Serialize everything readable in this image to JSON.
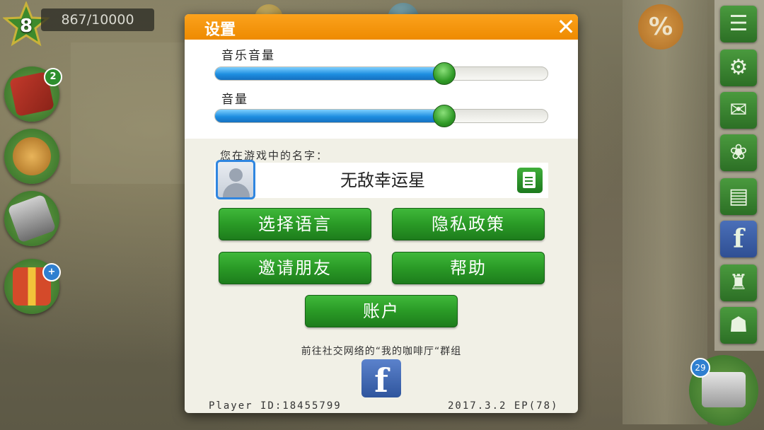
{
  "hud": {
    "level": "8",
    "xp": "867/10000",
    "discount_symbol": "%"
  },
  "left_buttons": [
    {
      "name": "recipe-book",
      "badge": "2"
    },
    {
      "name": "cooking-pot",
      "badge": ""
    },
    {
      "name": "telephone",
      "badge": ""
    },
    {
      "name": "gift-box",
      "badge": "+"
    }
  ],
  "sidebar": {
    "items": [
      "menu-list-icon",
      "gears-icon",
      "mail-icon",
      "food-dish-icon",
      "notepad-icon",
      "facebook-icon",
      "trophy-icon",
      "waiter-icon"
    ],
    "facebook_glyph": "f"
  },
  "register_badge": "29",
  "settings": {
    "title": "设置",
    "close_glyph": "✕",
    "music_volume_label": "音乐音量",
    "music_volume_level": 0.69,
    "sound_volume_label": "音量",
    "sound_volume_level": 0.69,
    "name_prompt": "您在游戏中的名字：",
    "player_name": "无敌幸运星",
    "buttons": {
      "language": "选择语言",
      "privacy": "隐私政策",
      "invite": "邀请朋友",
      "help": "帮助",
      "account": "账户"
    },
    "social_text": "前往社交网络的“我的咖啡厅“群组",
    "facebook_glyph": "f",
    "player_id": "Player ID:18455799",
    "version": "2017.3.2 EP(78)"
  },
  "colors": {
    "header_orange": "#f39412",
    "button_green": "#2a9a26",
    "slider_blue": "#1e8ee0"
  }
}
